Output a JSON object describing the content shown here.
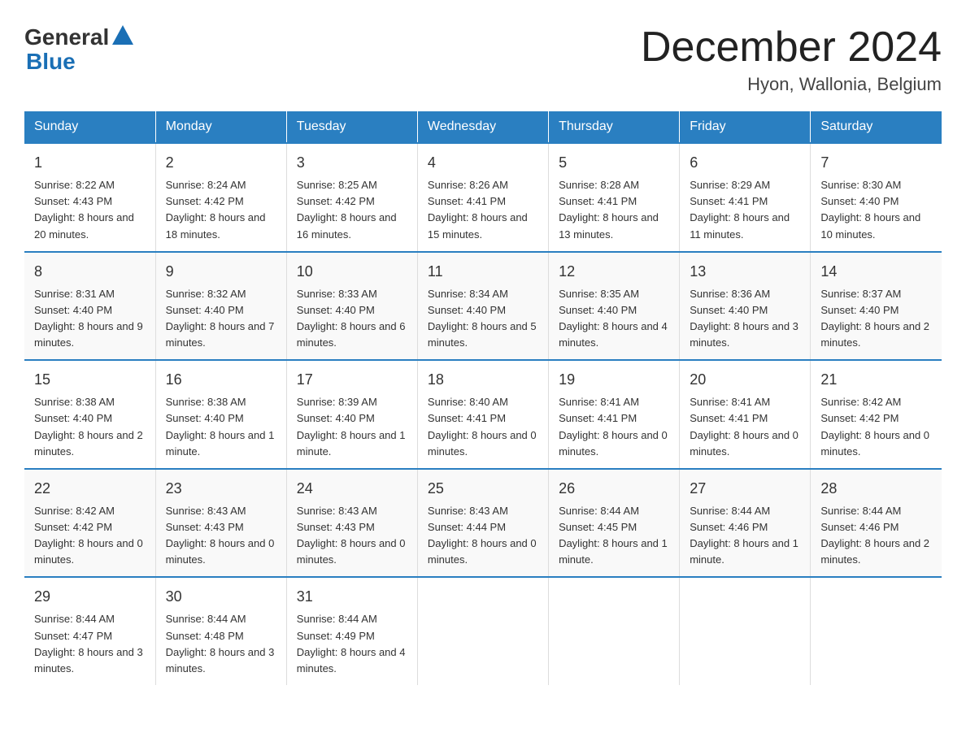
{
  "header": {
    "logo_general": "General",
    "logo_blue": "Blue",
    "month_title": "December 2024",
    "location": "Hyon, Wallonia, Belgium"
  },
  "days_of_week": [
    "Sunday",
    "Monday",
    "Tuesday",
    "Wednesday",
    "Thursday",
    "Friday",
    "Saturday"
  ],
  "weeks": [
    [
      {
        "day": "1",
        "sunrise": "8:22 AM",
        "sunset": "4:43 PM",
        "daylight": "8 hours and 20 minutes."
      },
      {
        "day": "2",
        "sunrise": "8:24 AM",
        "sunset": "4:42 PM",
        "daylight": "8 hours and 18 minutes."
      },
      {
        "day": "3",
        "sunrise": "8:25 AM",
        "sunset": "4:42 PM",
        "daylight": "8 hours and 16 minutes."
      },
      {
        "day": "4",
        "sunrise": "8:26 AM",
        "sunset": "4:41 PM",
        "daylight": "8 hours and 15 minutes."
      },
      {
        "day": "5",
        "sunrise": "8:28 AM",
        "sunset": "4:41 PM",
        "daylight": "8 hours and 13 minutes."
      },
      {
        "day": "6",
        "sunrise": "8:29 AM",
        "sunset": "4:41 PM",
        "daylight": "8 hours and 11 minutes."
      },
      {
        "day": "7",
        "sunrise": "8:30 AM",
        "sunset": "4:40 PM",
        "daylight": "8 hours and 10 minutes."
      }
    ],
    [
      {
        "day": "8",
        "sunrise": "8:31 AM",
        "sunset": "4:40 PM",
        "daylight": "8 hours and 9 minutes."
      },
      {
        "day": "9",
        "sunrise": "8:32 AM",
        "sunset": "4:40 PM",
        "daylight": "8 hours and 7 minutes."
      },
      {
        "day": "10",
        "sunrise": "8:33 AM",
        "sunset": "4:40 PM",
        "daylight": "8 hours and 6 minutes."
      },
      {
        "day": "11",
        "sunrise": "8:34 AM",
        "sunset": "4:40 PM",
        "daylight": "8 hours and 5 minutes."
      },
      {
        "day": "12",
        "sunrise": "8:35 AM",
        "sunset": "4:40 PM",
        "daylight": "8 hours and 4 minutes."
      },
      {
        "day": "13",
        "sunrise": "8:36 AM",
        "sunset": "4:40 PM",
        "daylight": "8 hours and 3 minutes."
      },
      {
        "day": "14",
        "sunrise": "8:37 AM",
        "sunset": "4:40 PM",
        "daylight": "8 hours and 2 minutes."
      }
    ],
    [
      {
        "day": "15",
        "sunrise": "8:38 AM",
        "sunset": "4:40 PM",
        "daylight": "8 hours and 2 minutes."
      },
      {
        "day": "16",
        "sunrise": "8:38 AM",
        "sunset": "4:40 PM",
        "daylight": "8 hours and 1 minute."
      },
      {
        "day": "17",
        "sunrise": "8:39 AM",
        "sunset": "4:40 PM",
        "daylight": "8 hours and 1 minute."
      },
      {
        "day": "18",
        "sunrise": "8:40 AM",
        "sunset": "4:41 PM",
        "daylight": "8 hours and 0 minutes."
      },
      {
        "day": "19",
        "sunrise": "8:41 AM",
        "sunset": "4:41 PM",
        "daylight": "8 hours and 0 minutes."
      },
      {
        "day": "20",
        "sunrise": "8:41 AM",
        "sunset": "4:41 PM",
        "daylight": "8 hours and 0 minutes."
      },
      {
        "day": "21",
        "sunrise": "8:42 AM",
        "sunset": "4:42 PM",
        "daylight": "8 hours and 0 minutes."
      }
    ],
    [
      {
        "day": "22",
        "sunrise": "8:42 AM",
        "sunset": "4:42 PM",
        "daylight": "8 hours and 0 minutes."
      },
      {
        "day": "23",
        "sunrise": "8:43 AM",
        "sunset": "4:43 PM",
        "daylight": "8 hours and 0 minutes."
      },
      {
        "day": "24",
        "sunrise": "8:43 AM",
        "sunset": "4:43 PM",
        "daylight": "8 hours and 0 minutes."
      },
      {
        "day": "25",
        "sunrise": "8:43 AM",
        "sunset": "4:44 PM",
        "daylight": "8 hours and 0 minutes."
      },
      {
        "day": "26",
        "sunrise": "8:44 AM",
        "sunset": "4:45 PM",
        "daylight": "8 hours and 1 minute."
      },
      {
        "day": "27",
        "sunrise": "8:44 AM",
        "sunset": "4:46 PM",
        "daylight": "8 hours and 1 minute."
      },
      {
        "day": "28",
        "sunrise": "8:44 AM",
        "sunset": "4:46 PM",
        "daylight": "8 hours and 2 minutes."
      }
    ],
    [
      {
        "day": "29",
        "sunrise": "8:44 AM",
        "sunset": "4:47 PM",
        "daylight": "8 hours and 3 minutes."
      },
      {
        "day": "30",
        "sunrise": "8:44 AM",
        "sunset": "4:48 PM",
        "daylight": "8 hours and 3 minutes."
      },
      {
        "day": "31",
        "sunrise": "8:44 AM",
        "sunset": "4:49 PM",
        "daylight": "8 hours and 4 minutes."
      },
      null,
      null,
      null,
      null
    ]
  ],
  "labels": {
    "sunrise": "Sunrise:",
    "sunset": "Sunset:",
    "daylight": "Daylight:"
  }
}
